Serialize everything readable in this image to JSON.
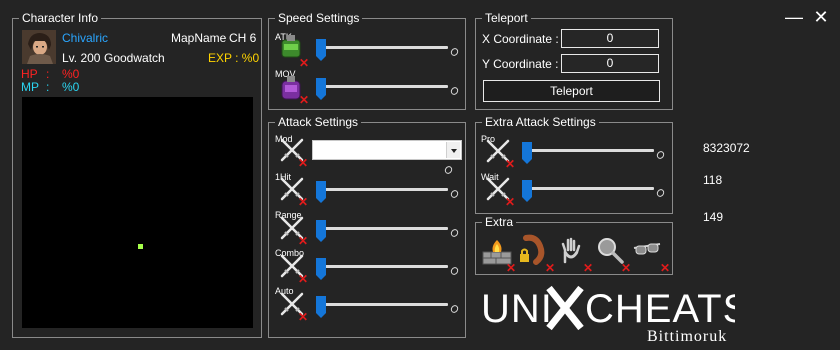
{
  "window": {
    "minimize_glyph": "—",
    "close_glyph": "✕"
  },
  "character_info": {
    "title": "Character Info",
    "name": "Chivalric",
    "map_label": "MapName",
    "map_value": "CH 6",
    "level_text": "Lv. 200",
    "guild": "Goodwatch",
    "exp_text": "EXP : %0",
    "hp_label": "HP",
    "hp_sep": ":",
    "hp_value": "%0",
    "mp_label": "MP",
    "mp_sep": ":",
    "mp_value": "%0",
    "colors": {
      "name": "#2aa6ff",
      "exp": "#ffd400",
      "hp": "#ff2222",
      "mp": "#2bd4f0"
    }
  },
  "speed_settings": {
    "title": "Speed Settings",
    "items": [
      {
        "label": "ATK",
        "icon": "green-potion-icon",
        "slider_fraction": 0
      },
      {
        "label": "MOV",
        "icon": "purple-potion-icon",
        "slider_fraction": 0
      }
    ]
  },
  "attack_settings": {
    "title": "Attack Settings",
    "mod": {
      "label": "Mod",
      "selected": ""
    },
    "items": [
      {
        "label": "1Hit",
        "slider_fraction": 0
      },
      {
        "label": "Range",
        "slider_fraction": 0
      },
      {
        "label": "Combo",
        "slider_fraction": 0
      },
      {
        "label": "Auto",
        "slider_fraction": 0
      }
    ]
  },
  "teleport": {
    "title": "Teleport",
    "x_label": "X Coordinate :",
    "x_value": "0",
    "y_label": "Y Coordinate :",
    "y_value": "0",
    "button_label": "Teleport"
  },
  "extra_attack_settings": {
    "title": "Extra Attack Settings",
    "items": [
      {
        "label": "Pro",
        "slider_fraction": 0
      },
      {
        "label": "Wait",
        "slider_fraction": 0
      }
    ]
  },
  "extra": {
    "title": "Extra",
    "icons": [
      "fire-wall-icon",
      "sausage-lock-icon",
      "hand-icon",
      "magnifier-icon",
      "goggles-icon"
    ]
  },
  "readouts": {
    "value1": "8323072",
    "value2": "118",
    "value3": "149"
  },
  "logo": {
    "main": "UNIXCHEATS",
    "sub": "Bittimoruk"
  },
  "x_glyph": "✕"
}
